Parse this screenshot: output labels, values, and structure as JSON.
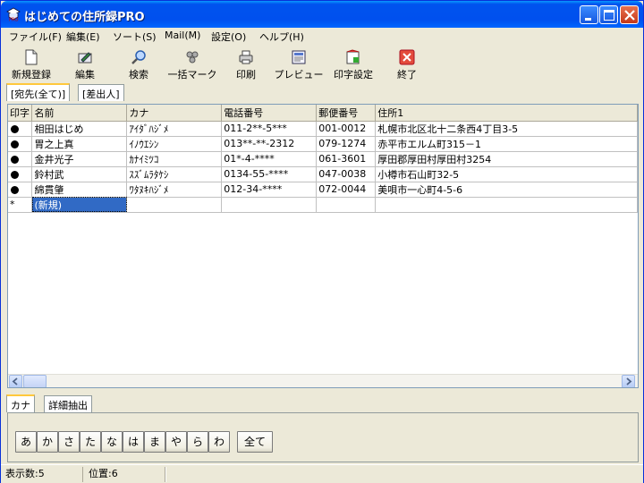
{
  "window": {
    "title": "はじめての住所録PRO"
  },
  "menu": [
    "ファイル(F)",
    "編集(E)",
    "ソート(S)",
    "Mail(M)",
    "設定(O)",
    "ヘルプ(H)"
  ],
  "toolbar": [
    {
      "label": "新規登録",
      "icon": "new-page-icon"
    },
    {
      "label": "編集",
      "icon": "edit-icon"
    },
    {
      "label": "検索",
      "icon": "search-icon"
    },
    {
      "label": "一括マーク",
      "icon": "bulk-mark-icon"
    },
    {
      "label": "印刷",
      "icon": "printer-icon"
    },
    {
      "label": "プレビュー",
      "icon": "preview-icon"
    },
    {
      "label": "印字設定",
      "icon": "print-settings-icon"
    },
    {
      "label": "終了",
      "icon": "exit-icon"
    }
  ],
  "tabs_top": [
    "[宛先(全て)]",
    "[差出人]"
  ],
  "grid": {
    "columns": [
      "印字",
      "名前",
      "カナ",
      "電話番号",
      "郵便番号",
      "住所1"
    ],
    "rows": [
      {
        "mark": true,
        "name": "相田はじめ",
        "kana": "ｱｲﾀﾞﾊｼﾞﾒ",
        "tel": "011-2**-5***",
        "zip": "001-0012",
        "address": "札幌市北区北十二条西4丁目3-5"
      },
      {
        "mark": true,
        "name": "胃之上真",
        "kana": "ｲﾉｳｴｼﾝ",
        "tel": "013**-**-2312",
        "zip": "079-1274",
        "address": "赤平市エルム町315－1"
      },
      {
        "mark": true,
        "name": "金井光子",
        "kana": "ｶﾅｲﾐﾂｺ",
        "tel": "01*-4-****",
        "zip": "061-3601",
        "address": "厚田郡厚田村厚田村3254"
      },
      {
        "mark": true,
        "name": "鈴村武",
        "kana": "ｽｽﾞﾑﾗﾀｹｼ",
        "tel": "0134-55-****",
        "zip": "047-0038",
        "address": "小樽市石山町32-5"
      },
      {
        "mark": true,
        "name": "綿貫肇",
        "kana": "ﾜﾀﾇｷﾊｼﾞﾒ",
        "tel": "012-34-****",
        "zip": "072-0044",
        "address": "美唄市一心町4-5-6"
      }
    ],
    "new_row_marker": "*",
    "new_row_label": "(新規)"
  },
  "tabs_bottom": [
    "カナ",
    "詳細抽出"
  ],
  "kana_buttons": [
    "あ",
    "か",
    "さ",
    "た",
    "な",
    "は",
    "ま",
    "や",
    "ら",
    "わ"
  ],
  "all_button": "全て",
  "status": {
    "count": "表示数:5",
    "position": "位置:6"
  }
}
